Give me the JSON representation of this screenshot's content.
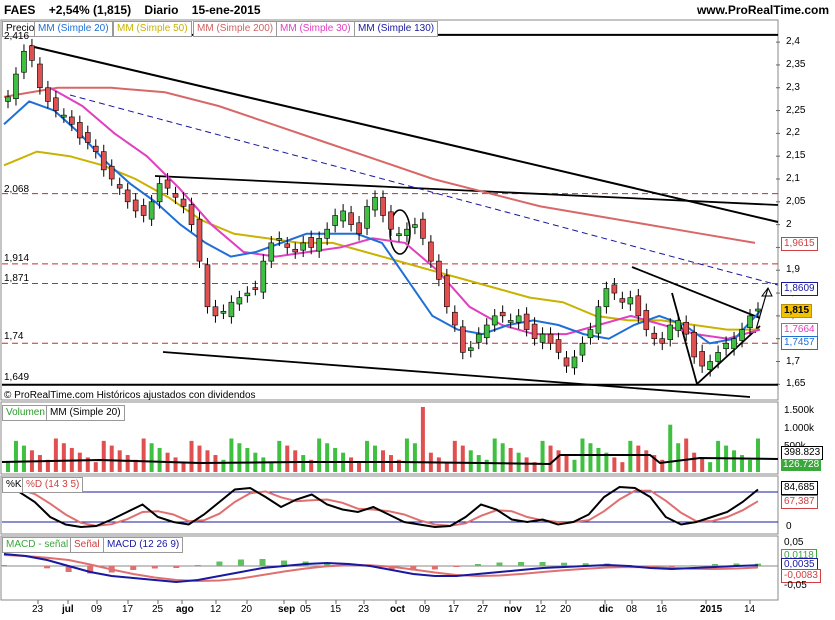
{
  "header": {
    "ticker": "FAES",
    "change": "+2,54% (1,815)",
    "period": "Diario",
    "date": "15-ene-2015",
    "site": "www.ProRealTime.com"
  },
  "price_panel": {
    "legend": [
      "Precio",
      "MM (Simple 20)",
      "MM (Simple 50)",
      "MM (Simple 200)",
      "MM (Simple 30)",
      "MM (Simple 130)"
    ],
    "note": "© ProRealTime.com Históricos ajustados con dividendos",
    "y_ticks": [
      "2,4",
      "2,35",
      "2,3",
      "2,25",
      "2,2",
      "2,15",
      "2,1",
      "2,05",
      "2",
      "1,95",
      "1,9",
      "1,85",
      "1,8",
      "1,75",
      "1,7",
      "1,65"
    ],
    "left_levels": [
      "2,416",
      "2,068",
      "1,914",
      "1,871",
      "1,74",
      "1,649"
    ],
    "right_tags": [
      "1,9615",
      "1,8609",
      "1,815",
      "1,7664",
      "1,7457"
    ]
  },
  "volume_panel": {
    "legend": [
      "Volumen",
      "MM (Simple 20)"
    ],
    "y_ticks": [
      "1.500k",
      "1.000k",
      "500k"
    ],
    "right_tags": [
      "398.823",
      "126.728"
    ]
  },
  "stoch_panel": {
    "legend": [
      "%K",
      "%D (14 3 5)"
    ],
    "y_ticks": [
      "0"
    ],
    "right_tags": [
      "84,685",
      "67,387"
    ]
  },
  "macd_panel": {
    "legend": [
      "MACD - señal",
      "Señal",
      "MACD (12 26 9)"
    ],
    "y_ticks": [
      "0,05",
      "-0,05"
    ],
    "right_tags": [
      "0,0118",
      "0,0035",
      "-0,0083"
    ]
  },
  "x_axis": {
    "labels": [
      "23",
      "jul",
      "09",
      "17",
      "25",
      "ago",
      "12",
      "20",
      "sep",
      "05",
      "15",
      "23",
      "oct",
      "09",
      "17",
      "27",
      "nov",
      "12",
      "20",
      "dic",
      "08",
      "16",
      "2015",
      "14"
    ]
  },
  "chart_data": {
    "type": "candlestick",
    "y_range": [
      1.62,
      2.42
    ],
    "close_series_approx": [
      2.28,
      2.33,
      2.38,
      2.36,
      2.3,
      2.27,
      2.25,
      2.24,
      2.22,
      2.19,
      2.18,
      2.16,
      2.12,
      2.1,
      2.08,
      2.05,
      2.03,
      2.02,
      2.05,
      2.09,
      2.08,
      2.06,
      2.04,
      2.0,
      1.92,
      1.82,
      1.8,
      1.81,
      1.83,
      1.84,
      1.85,
      1.86,
      1.92,
      1.96,
      1.97,
      1.95,
      1.94,
      1.96,
      1.95,
      1.97,
      1.99,
      2.02,
      2.03,
      2.0,
      1.98,
      2.04,
      2.06,
      2.02,
      1.99,
      1.98,
      1.99,
      2.0,
      1.97,
      1.92,
      1.88,
      1.82,
      1.78,
      1.72,
      1.73,
      1.76,
      1.78,
      1.8,
      1.8,
      1.79,
      1.8,
      1.77,
      1.75,
      1.76,
      1.74,
      1.72,
      1.69,
      1.71,
      1.74,
      1.77,
      1.82,
      1.86,
      1.85,
      1.83,
      1.84,
      1.8,
      1.77,
      1.75,
      1.74,
      1.78,
      1.79,
      1.76,
      1.71,
      1.69,
      1.7,
      1.72,
      1.74,
      1.75,
      1.77,
      1.8,
      1.815
    ],
    "sma20_approx": [
      2.22,
      2.27,
      2.25,
      2.2,
      2.14,
      2.09,
      2.05,
      2.0,
      1.96,
      1.93,
      1.94,
      1.96,
      1.98,
      1.98,
      1.98,
      1.96,
      1.88,
      1.8,
      1.77,
      1.76,
      1.78,
      1.79,
      1.78,
      1.76,
      1.75,
      1.78,
      1.8,
      1.78,
      1.74,
      1.75,
      1.81
    ],
    "sma50_approx": [
      2.13,
      2.16,
      2.15,
      2.13,
      2.1,
      2.06,
      2.01,
      1.98,
      1.97,
      1.96,
      1.96,
      1.94,
      1.92,
      1.9,
      1.88,
      1.86,
      1.84,
      1.83,
      1.8,
      1.79,
      1.79,
      1.78,
      1.77,
      1.77
    ],
    "sma200_approx": [
      2.28,
      2.3,
      2.3,
      2.29,
      2.26,
      2.22,
      2.18,
      2.14,
      2.1,
      2.07,
      2.04,
      2.02,
      2.0,
      1.98,
      1.96
    ],
    "sma30_approx": [
      2.3,
      2.26,
      2.2,
      2.15,
      2.08,
      2.0,
      1.94,
      1.93,
      1.94,
      1.95,
      1.97,
      1.96,
      1.9,
      1.82,
      1.78,
      1.76,
      1.76,
      1.78,
      1.8,
      1.78,
      1.76,
      1.75,
      1.77
    ],
    "sma130_approx": [
      2.26,
      2.22,
      2.18,
      2.14,
      2.1,
      2.06,
      2.02,
      1.98,
      1.95,
      1.91,
      1.88,
      1.86
    ],
    "volume_sma20": 398823,
    "volume_last": 126728,
    "stoch_K": 84.685,
    "stoch_D": 67.387,
    "macd": 0.0035,
    "macd_signal": -0.0083,
    "macd_hist": 0.0118
  }
}
